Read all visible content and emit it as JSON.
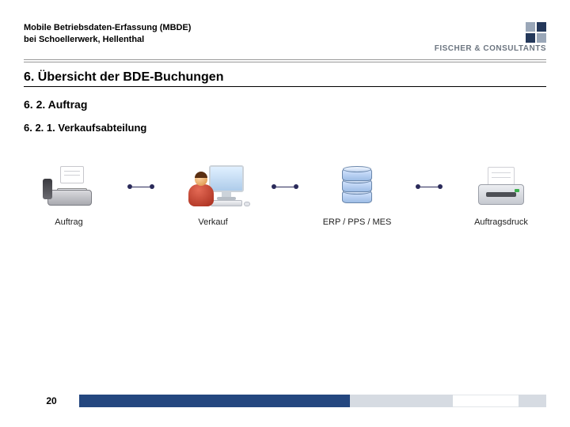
{
  "header": {
    "line1": "Mobile Betriebsdaten-Erfassung (MBDE)",
    "line2": "bei Schoellerwerk, Hellenthal",
    "logo_text": "FISCHER & CONSULTANTS"
  },
  "section": {
    "title": "6. Übersicht der BDE-Buchungen",
    "sub1": "6. 2. Auftrag",
    "sub2": "6. 2. 1. Verkaufsabteilung"
  },
  "flow": {
    "nodes": [
      {
        "label": "Auftrag"
      },
      {
        "label": "Verkauf"
      },
      {
        "label": "ERP / PPS / MES"
      },
      {
        "label": "Auftragsdruck"
      }
    ]
  },
  "footer": {
    "page": "20"
  }
}
